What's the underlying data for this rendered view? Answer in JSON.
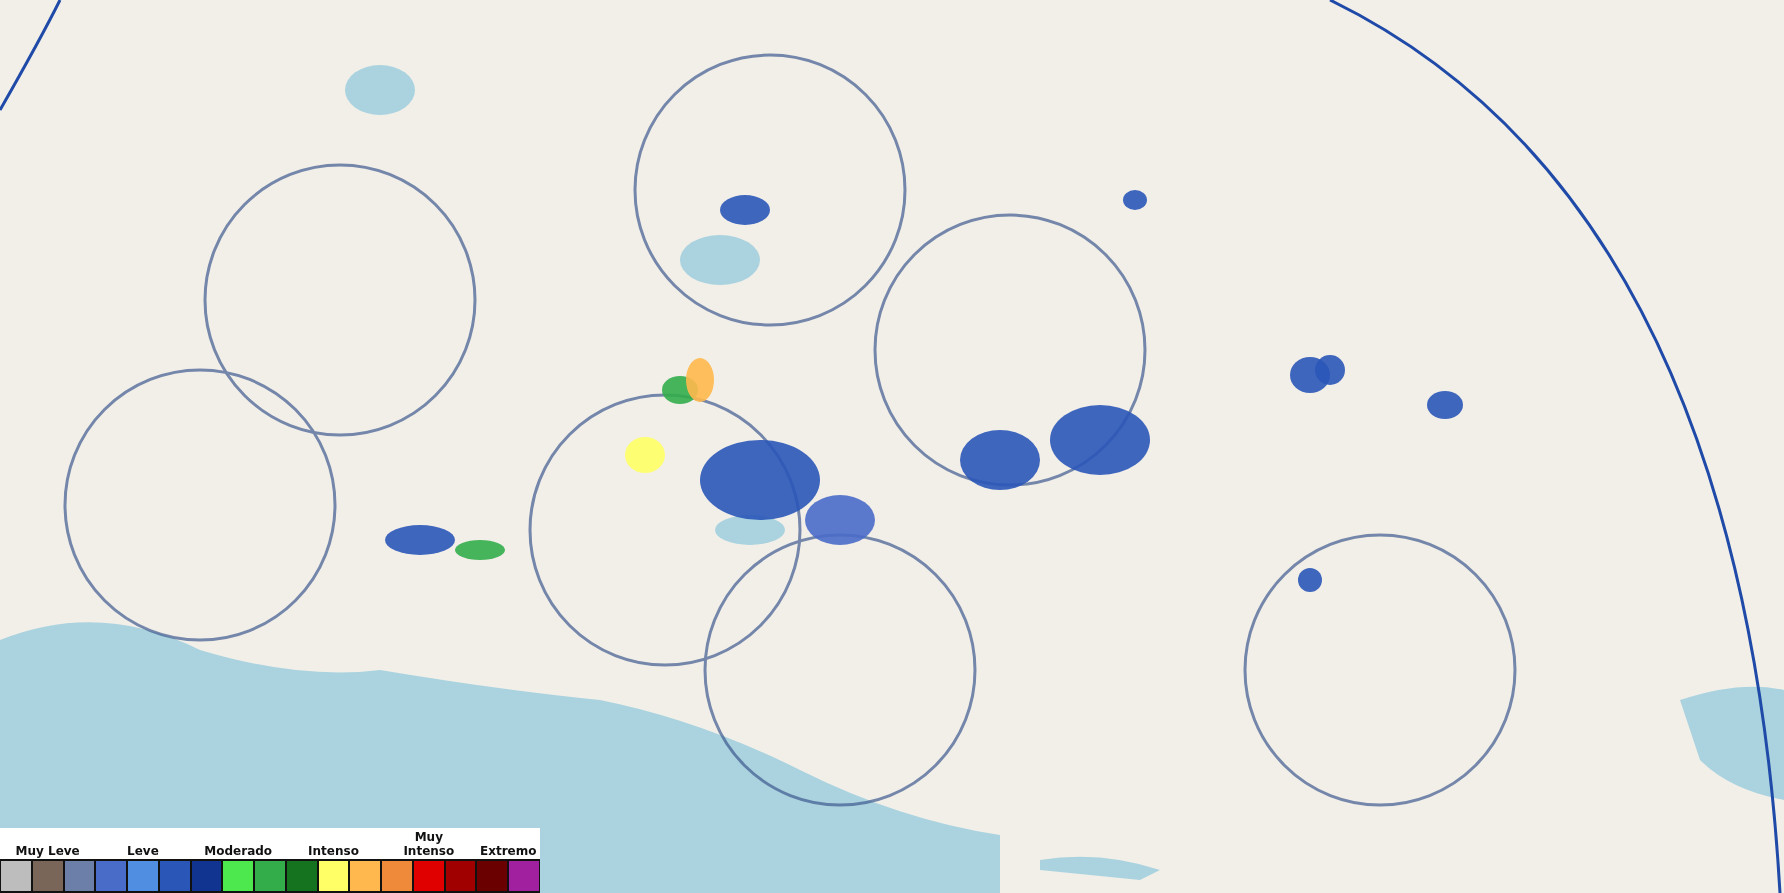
{
  "legend": {
    "groups": [
      {
        "label": "Muy Leve",
        "swatches": [
          {
            "color": "#bdbdbd"
          },
          {
            "color": "#7a6659"
          },
          {
            "color": "#6b7fa8"
          }
        ]
      },
      {
        "label": "Leve",
        "swatches": [
          {
            "color": "#4a6cc9"
          },
          {
            "color": "#4f8ee0"
          },
          {
            "color": "#2a56b8"
          }
        ]
      },
      {
        "label": "Moderado",
        "swatches": [
          {
            "color": "#10348f"
          },
          {
            "color": "#4de84d"
          },
          {
            "color": "#33ad4a"
          }
        ]
      },
      {
        "label": "Intenso",
        "swatches": [
          {
            "color": "#157320"
          },
          {
            "color": "#ffff66"
          },
          {
            "color": "#ffb84d"
          }
        ]
      },
      {
        "label": "Muy Intenso",
        "swatches": [
          {
            "color": "#ee8a3a"
          },
          {
            "color": "#e00000"
          },
          {
            "color": "#a00000"
          }
        ]
      },
      {
        "label": "Extremo",
        "swatches": [
          {
            "color": "#6b0000"
          },
          {
            "color": "#a020a0"
          }
        ]
      }
    ]
  }
}
